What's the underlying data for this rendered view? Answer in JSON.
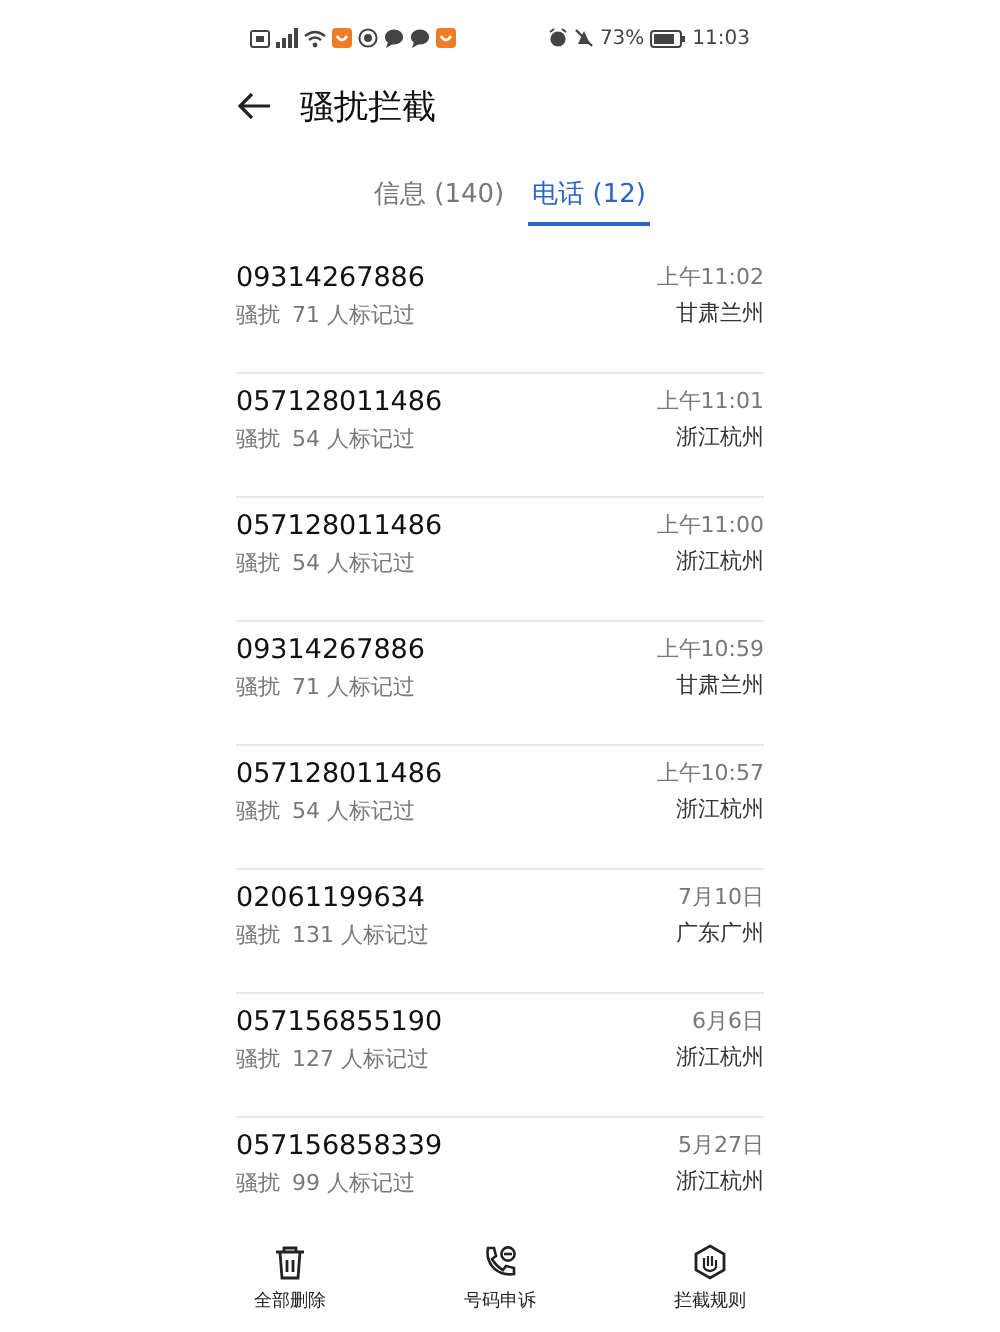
{
  "status_bar": {
    "battery": "73%",
    "time": "11:03"
  },
  "header": {
    "title": "骚扰拦截"
  },
  "tabs": [
    {
      "label": "信息 (140)",
      "selected": false
    },
    {
      "label": "电话 (12)",
      "selected": true
    }
  ],
  "calls": [
    {
      "number": "09314267886",
      "tag": "骚扰",
      "marks": "71 人标记过",
      "time": "上午11:02",
      "location": "甘肃兰州"
    },
    {
      "number": "057128011486",
      "tag": "骚扰",
      "marks": "54 人标记过",
      "time": "上午11:01",
      "location": "浙江杭州"
    },
    {
      "number": "057128011486",
      "tag": "骚扰",
      "marks": "54 人标记过",
      "time": "上午11:00",
      "location": "浙江杭州"
    },
    {
      "number": "09314267886",
      "tag": "骚扰",
      "marks": "71 人标记过",
      "time": "上午10:59",
      "location": "甘肃兰州"
    },
    {
      "number": "057128011486",
      "tag": "骚扰",
      "marks": "54 人标记过",
      "time": "上午10:57",
      "location": "浙江杭州"
    },
    {
      "number": "02061199634",
      "tag": "骚扰",
      "marks": "131 人标记过",
      "time": "7月10日",
      "location": "广东广州"
    },
    {
      "number": "057156855190",
      "tag": "骚扰",
      "marks": "127 人标记过",
      "time": "6月6日",
      "location": "浙江杭州"
    },
    {
      "number": "057156858339",
      "tag": "骚扰",
      "marks": "99 人标记过",
      "time": "5月27日",
      "location": "浙江杭州"
    }
  ],
  "toolbar": [
    {
      "kind": "delete",
      "label": "全部删除"
    },
    {
      "kind": "appeal",
      "label": "号码申诉"
    },
    {
      "kind": "rules",
      "label": "拦截规则"
    }
  ]
}
